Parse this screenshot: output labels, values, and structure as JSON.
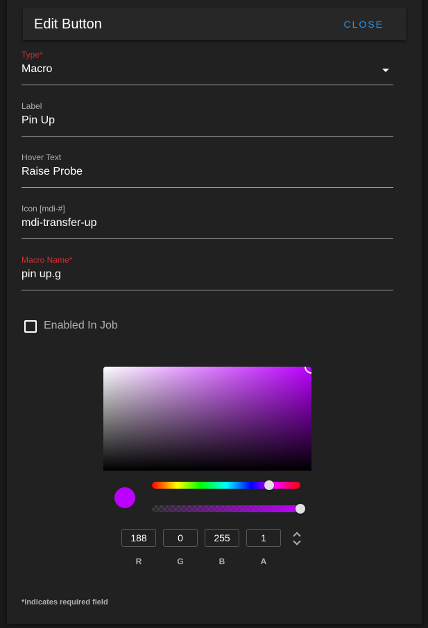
{
  "dialog": {
    "title": "Edit Button",
    "close_label": "CLOSE"
  },
  "fields": [
    {
      "label": "Type*",
      "value": "Macro",
      "required": true,
      "dropdown": true
    },
    {
      "label": "Label",
      "value": "Pin Up",
      "required": false
    },
    {
      "label": "Hover Text",
      "value": "Raise Probe",
      "required": false
    },
    {
      "label": "Icon [mdi-#]",
      "value": "mdi-transfer-up",
      "required": false
    },
    {
      "label": "Macro Name*",
      "value": "pin up.g",
      "required": true
    }
  ],
  "enabled_in_job": {
    "label": "Enabled In Job",
    "checked": false
  },
  "color_picker": {
    "color_hex": "#bc00ff",
    "hue_fraction": 0.79,
    "saturation": 1.0,
    "brightness": 1.0,
    "alpha_fraction": 1.0,
    "channels": [
      {
        "value": "188",
        "label": "R"
      },
      {
        "value": "0",
        "label": "G"
      },
      {
        "value": "255",
        "label": "B"
      },
      {
        "value": "1",
        "label": "A"
      }
    ]
  },
  "footnote": "*indicates required field",
  "colors": {
    "accent": "#2196f3",
    "required": "#d32f2f",
    "background": "#212121"
  }
}
